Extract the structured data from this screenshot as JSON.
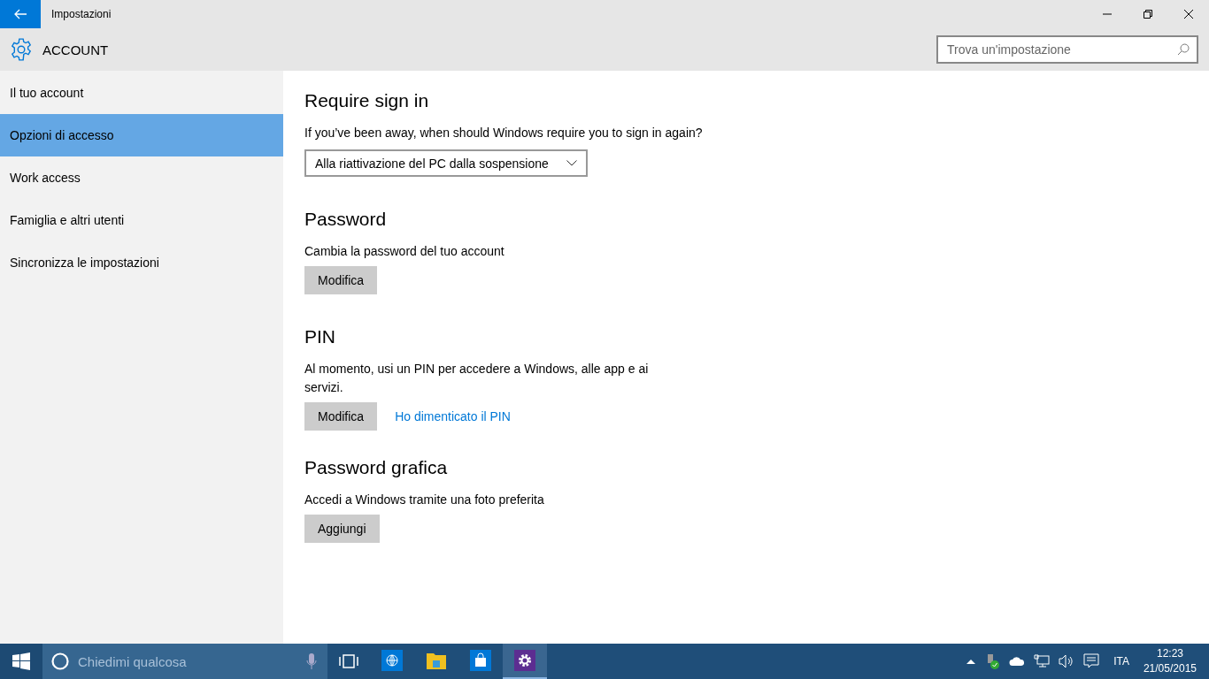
{
  "window": {
    "title": "Impostazioni"
  },
  "header": {
    "title": "ACCOUNT",
    "search": {
      "placeholder": "Trova un'impostazione"
    }
  },
  "sidebar": {
    "items": [
      {
        "label": "Il tuo account",
        "selected": false
      },
      {
        "label": "Opzioni di accesso",
        "selected": true
      },
      {
        "label": "Work access",
        "selected": false
      },
      {
        "label": "Famiglia e altri utenti",
        "selected": false
      },
      {
        "label": "Sincronizza le impostazioni",
        "selected": false
      }
    ]
  },
  "sections": [
    {
      "heading": "Require sign in",
      "description": "If you’ve been away, when should Windows require you to sign in again?",
      "dropdown": "Alla riattivazione del PC dalla sospensione"
    },
    {
      "heading": "Password",
      "description": "Cambia la password del tuo account",
      "actions": [
        {
          "kind": "button",
          "label": "Modifica"
        }
      ]
    },
    {
      "heading": "PIN",
      "description": "Al momento, usi un PIN per accedere a Windows, alle app e ai servizi.",
      "actions": [
        {
          "kind": "button",
          "label": "Modifica"
        },
        {
          "kind": "link",
          "label": "Ho dimenticato il PIN"
        }
      ]
    },
    {
      "heading": "Password grafica",
      "description": "Accedi a Windows tramite una foto preferita",
      "actions": [
        {
          "kind": "button",
          "label": "Aggiungi"
        }
      ]
    }
  ],
  "taskbar": {
    "search": {
      "placeholder": "Chiedimi qualcosa"
    },
    "apps": [
      {
        "kind": "browser",
        "selected": false
      },
      {
        "kind": "folder",
        "selected": false
      },
      {
        "kind": "store",
        "selected": false
      },
      {
        "kind": "settings",
        "selected": true
      }
    ],
    "language": "ITA",
    "time": "12:23",
    "date": "21/05/2015"
  }
}
